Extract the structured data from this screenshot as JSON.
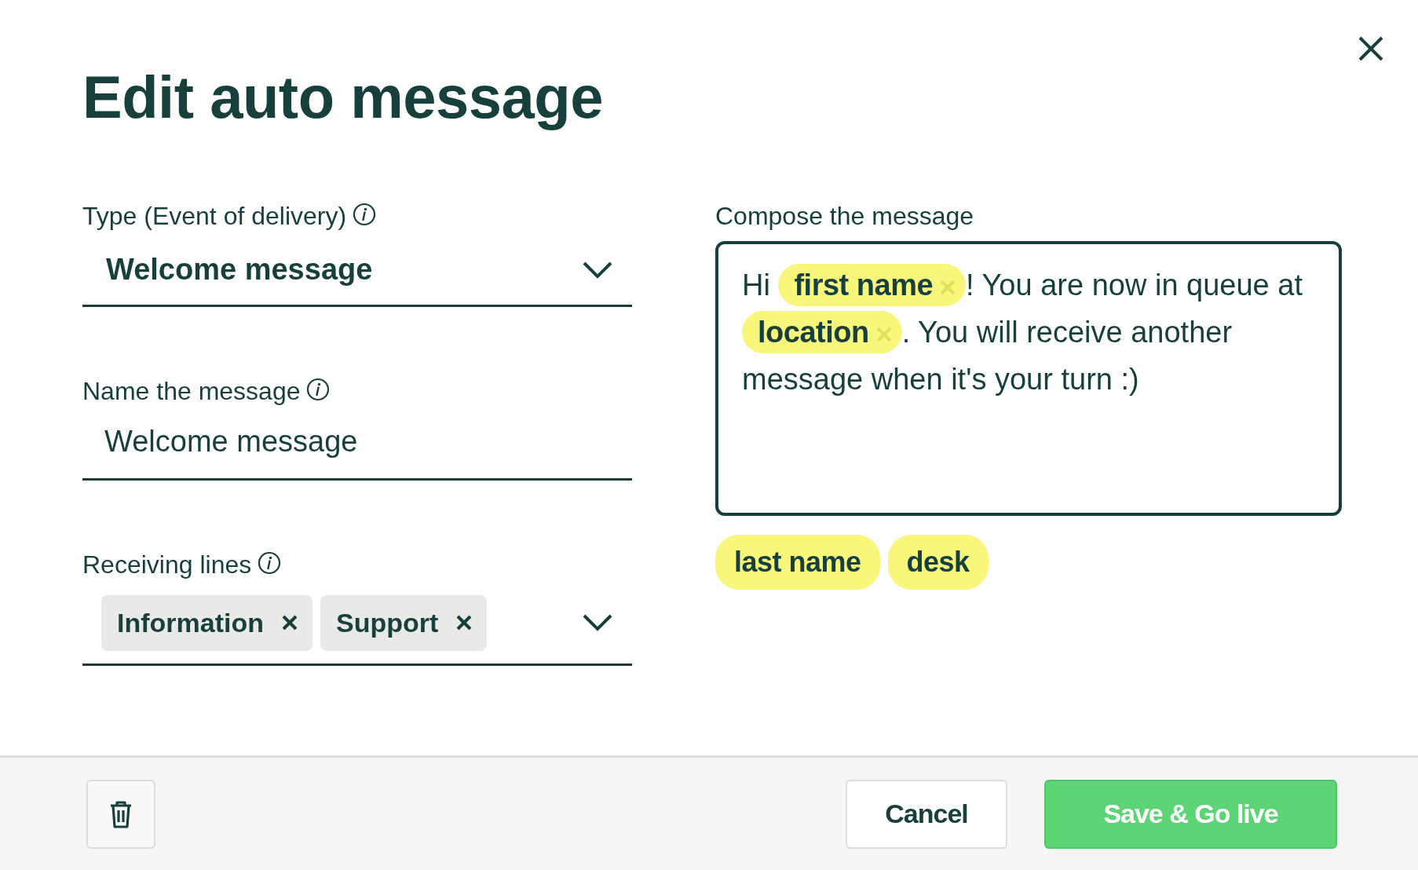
{
  "dialog": {
    "title": "Edit auto message"
  },
  "type_field": {
    "label": "Type (Event of delivery)",
    "value": "Welcome message"
  },
  "name_field": {
    "label": "Name the message",
    "value": "Welcome message"
  },
  "receiving_lines": {
    "label": "Receiving lines",
    "chips": [
      "Information",
      "Support"
    ]
  },
  "compose": {
    "label": "Compose the message",
    "segments": [
      {
        "kind": "text",
        "text": "Hi "
      },
      {
        "kind": "tag",
        "text": "first name"
      },
      {
        "kind": "text",
        "text": "! You are now in queue at "
      },
      {
        "kind": "tag",
        "text": "location"
      },
      {
        "kind": "text",
        "text": ". You will receive another message when it's your turn :)"
      }
    ],
    "available_tags": [
      "last name",
      "desk"
    ]
  },
  "footer": {
    "buttons": [
      {
        "kind": "secondary",
        "label": "Cancel"
      },
      {
        "kind": "primary",
        "label": "Save & Go live"
      }
    ]
  }
}
